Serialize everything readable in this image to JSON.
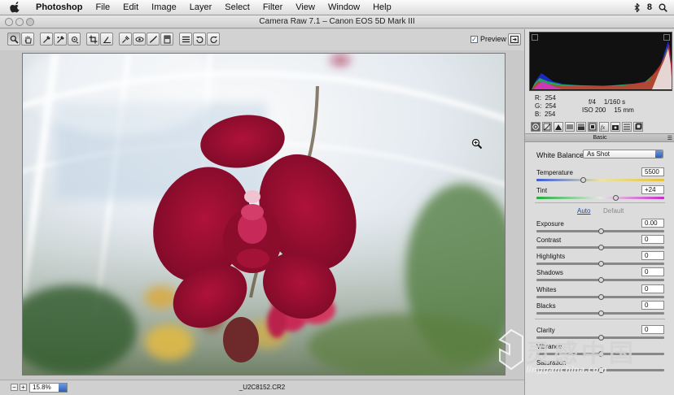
{
  "menubar": {
    "app_name": "Photoshop",
    "items": [
      "File",
      "Edit",
      "Image",
      "Layer",
      "Select",
      "Filter",
      "View",
      "Window",
      "Help"
    ],
    "status_right": "8",
    "icons": [
      "apple-icon",
      "bluetooth-icon",
      "spotlight-icon"
    ]
  },
  "window": {
    "title": "Camera Raw 7.1  –  Canon EOS 5D Mark III"
  },
  "toolbar": {
    "tools": [
      "zoom-tool-icon",
      "hand-tool-icon",
      "white-balance-tool-icon",
      "color-sampler-tool-icon",
      "targeted-adjustment-tool-icon",
      "crop-tool-icon",
      "straighten-tool-icon",
      "spot-removal-tool-icon",
      "red-eye-removal-tool-icon",
      "adjustment-brush-icon",
      "graduated-filter-icon",
      "preferences-icon",
      "rotate-ccw-icon",
      "rotate-cw-icon"
    ],
    "preview_label": "Preview",
    "preview_checked": true
  },
  "status": {
    "zoom": "15.8%",
    "filename": "_U2C8152.CR2"
  },
  "histogram": {
    "rgb": {
      "r_label": "R:",
      "r": "254",
      "g_label": "G:",
      "g": "254",
      "b_label": "B:",
      "b": "254"
    },
    "aperture": "f/4",
    "shutter": "1/160 s",
    "iso": "ISO 200",
    "focal": "15 mm"
  },
  "panel": {
    "section_title": "Basic",
    "white_balance_label": "White Balance:",
    "white_balance_value": "As Shot",
    "auto_label": "Auto",
    "default_label": "Default",
    "sliders": [
      {
        "label": "Temperature",
        "value": "5500",
        "level": 0.36
      },
      {
        "label": "Tint",
        "value": "+24",
        "level": 0.62
      },
      {
        "label": "Exposure",
        "value": "0.00",
        "level": 0.5
      },
      {
        "label": "Contrast",
        "value": "0",
        "level": 0.5
      },
      {
        "label": "Highlights",
        "value": "0",
        "level": 0.5
      },
      {
        "label": "Shadows",
        "value": "0",
        "level": 0.5
      },
      {
        "label": "Whites",
        "value": "0",
        "level": 0.5
      },
      {
        "label": "Blacks",
        "value": "0",
        "level": 0.5
      },
      {
        "label": "Clarity",
        "value": "0",
        "level": 0.5
      },
      {
        "label": "Vibrance",
        "value": "",
        "level": 0.5
      },
      {
        "label": "Saturation",
        "value": "",
        "level": 0.5
      }
    ]
  },
  "watermark": {
    "title": "灵感中国",
    "subtitle": "lingganchina.com"
  }
}
